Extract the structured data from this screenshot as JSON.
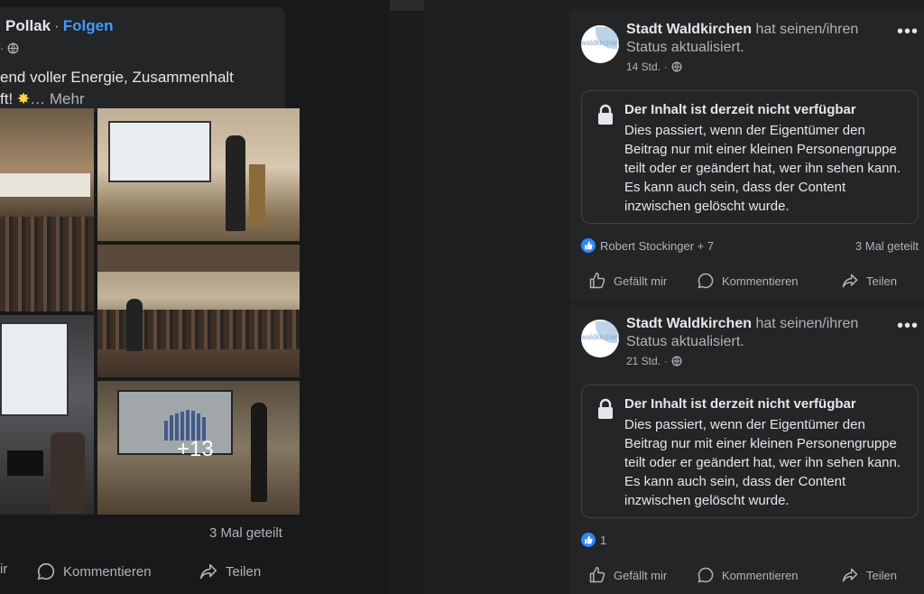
{
  "left_post": {
    "author": "Pollak",
    "separator": "·",
    "follow_label": "Folgen",
    "text": "end voller Energie, Zusammenhalt",
    "text_line2": "ft!",
    "more_label": "… Mehr",
    "photos_more": "+13",
    "shares": "3 Mal geteilt",
    "actions": {
      "like": "ir",
      "comment": "Kommentieren",
      "share": "Teilen"
    }
  },
  "right_posts": [
    {
      "author": "Stadt Waldkirchen",
      "status_text": "hat seinen/ihren Status aktualisiert.",
      "time": "14 Std.",
      "avatar_text": "waldkirchen",
      "unavailable": {
        "title": "Der Inhalt ist derzeit nicht verfügbar",
        "body": "Dies passiert, wenn der Eigentümer den Beitrag nur mit einer kleinen Personengruppe teilt oder er geändert hat, wer ihn sehen kann. Es kann auch sein, dass der Content inzwischen gelöscht wurde."
      },
      "reactions": "Robert Stockinger + 7",
      "shares": "3 Mal geteilt",
      "actions": {
        "like": "Gefällt mir",
        "comment": "Kommentieren",
        "share": "Teilen"
      }
    },
    {
      "author": "Stadt Waldkirchen",
      "status_text": "hat seinen/ihren Status aktualisiert.",
      "time": "21 Std.",
      "avatar_text": "waldkirchen",
      "unavailable": {
        "title": "Der Inhalt ist derzeit nicht verfügbar",
        "body": "Dies passiert, wenn der Eigentümer den Beitrag nur mit einer kleinen Personengruppe teilt oder er geändert hat, wer ihn sehen kann. Es kann auch sein, dass der Content inzwischen gelöscht wurde."
      },
      "reactions": "1",
      "actions": {
        "like": "Gefällt mir",
        "comment": "Kommentieren",
        "share": "Teilen"
      }
    }
  ],
  "icons": {
    "globe": "globe-icon",
    "lock": "lock-icon",
    "like": "thumbs-up-icon",
    "comment": "comment-bubble-icon",
    "share": "share-arrow-icon",
    "more": "more-dots-icon",
    "sun": "sparkle-emoji-icon"
  },
  "colors": {
    "background": "#18191a",
    "card": "#242526",
    "text_primary": "#e4e6eb",
    "text_secondary": "#b0b3b8",
    "link_blue": "#4599ff",
    "like_blue": "#2d88ff"
  }
}
